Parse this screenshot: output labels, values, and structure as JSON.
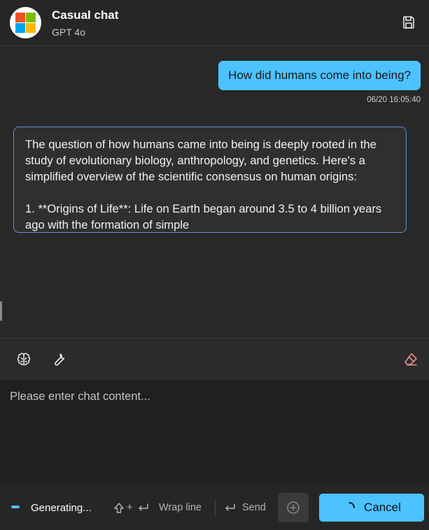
{
  "header": {
    "title": "Casual chat",
    "subtitle": "GPT 4o",
    "logo_colors": [
      "#f25022",
      "#7fba00",
      "#00a4ef",
      "#ffb900"
    ]
  },
  "messages": [
    {
      "role": "user",
      "text": "How did humans come into being?",
      "timestamp": "06/20 16:05:40"
    },
    {
      "role": "assistant",
      "text": "The question of how humans came into being is deeply rooted in the study of evolutionary biology, anthropology, and genetics. Here's a simplified overview of the scientific consensus on human origins:\n\n1. **Origins of Life**: Life on Earth began around 3.5 to 4 billion years ago with the formation of simple"
    }
  ],
  "toolbar": {
    "left_tools": [
      "brain-icon",
      "wrench-icon"
    ],
    "right_tools": [
      "eraser-icon"
    ]
  },
  "input": {
    "placeholder": "Please enter chat content...",
    "value": ""
  },
  "footer": {
    "status": "Generating...",
    "wrap_hint": "Wrap line",
    "send_hint": "Send",
    "cancel_label": "Cancel"
  },
  "colors": {
    "accent": "#4cc2ff",
    "background": "#272727",
    "bubble_border": "#5e8fd6",
    "eraser": "#e88a8a"
  }
}
